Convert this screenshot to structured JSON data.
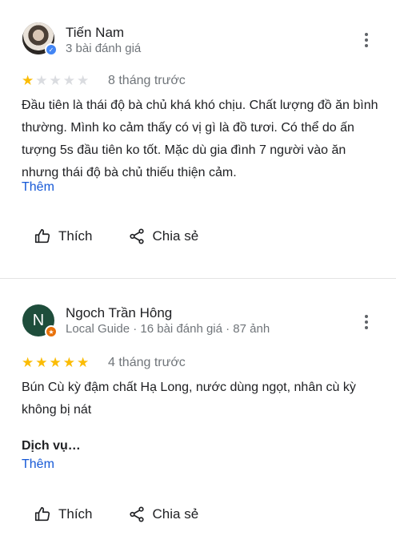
{
  "reviews": [
    {
      "author": "Tiến Nam",
      "meta": "3 bài đánh giá",
      "rating": 1,
      "time_ago": "8 tháng trước",
      "text": "Đầu tiên là thái độ bà chủ khá khó chịu. Chất lượng đồ ăn bình thường. Mình ko cảm thấy có vị gì là đồ tươi. Có thể do ấn tượng 5s đầu tiên ko tốt. Mặc dù gia đình 7 người vào ăn nhưng thái độ bà chủ thiếu thiện cảm.",
      "more_label": "Thêm",
      "like_label": "Thích",
      "share_label": "Chia sẻ"
    },
    {
      "author": "Ngoch Trần Hông",
      "avatar_initial": "N",
      "meta": "Local Guide · 16 bài đánh giá · 87 ảnh",
      "rating": 5,
      "time_ago": "4 tháng trước",
      "text": "Bún Cù kỳ đậm chất Hạ Long, nước dùng ngọt, nhân cù kỳ không bị nát",
      "section_label": "Dịch vụ…",
      "more_label": "Thêm",
      "like_label": "Thích",
      "share_label": "Chia sẻ"
    }
  ],
  "colors": {
    "star_filled": "#fbbc04",
    "star_empty": "#dadce0",
    "link": "#1558d6",
    "avatar_green": "#1e4d3b",
    "local_guide_badge": "#e8710a"
  },
  "icons": [
    "verified-badge-icon",
    "local-guide-badge-icon",
    "more-options-icon",
    "star-icon",
    "thumbs-up-icon",
    "share-icon"
  ]
}
